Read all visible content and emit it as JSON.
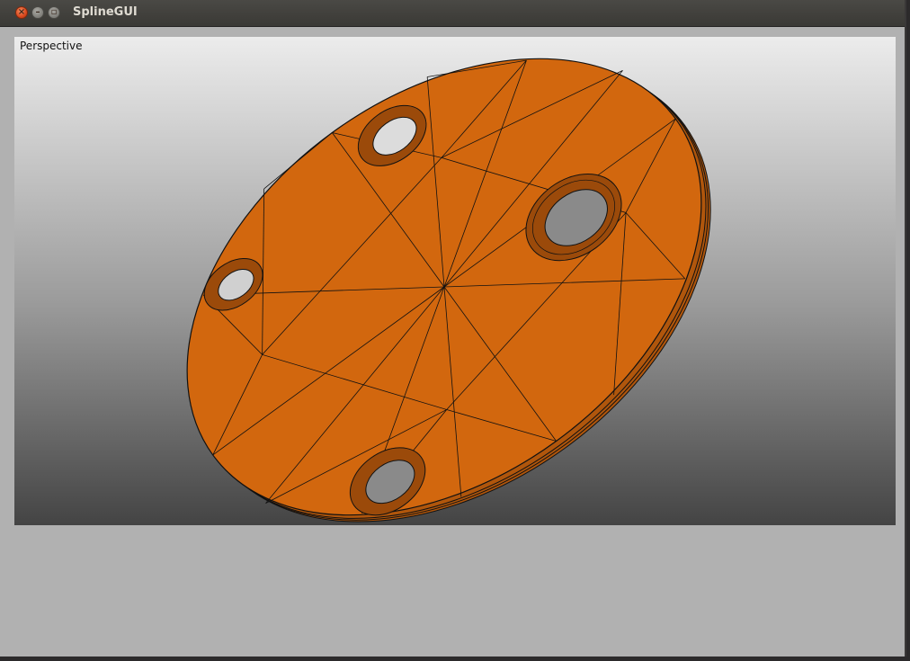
{
  "window": {
    "title": "SplineGUI"
  },
  "viewport": {
    "label": "Perspective"
  },
  "colors": {
    "part": "#d2670e",
    "edge": "#111111",
    "rim": "#b85a0c",
    "hole": "#8a8a8a"
  },
  "icons": {
    "close": "close-icon",
    "minimize": "minimize-icon",
    "maximize": "maximize-icon"
  }
}
